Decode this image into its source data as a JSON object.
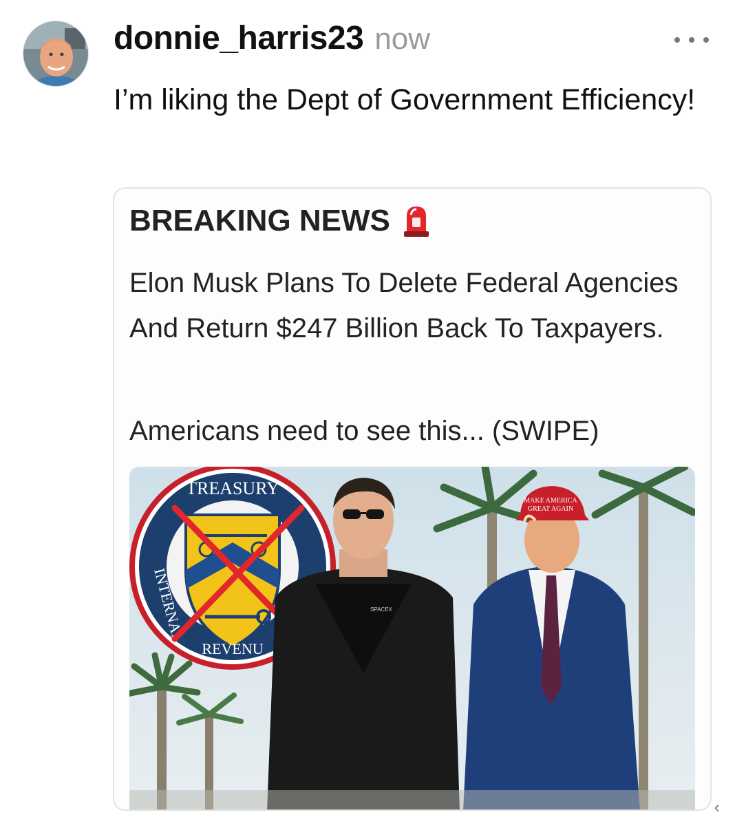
{
  "post": {
    "username": "donnie_harris23",
    "timestamp": "now",
    "text": "I’m liking the Dept of Government Efficiency!",
    "more_icon": "more-horizontal-icon"
  },
  "card": {
    "headline": "BREAKING NEWS",
    "headline_icon": "siren-icon",
    "body": "Elon Musk Plans To Delete Federal Agencies And Return $247 Billion Back To Taxpayers.",
    "cta": "Americans need to see this... (SWIPE)",
    "image": {
      "seal_top_text": "TREASURY",
      "seal_left_text": "INTERNAL",
      "seal_bottom_text": "REVENU",
      "hat_text_line1": "MAKE AMERICA",
      "hat_text_line2": "GREAT AGAIN",
      "shirt_text": "SPACEX"
    }
  },
  "colors": {
    "text": "#111111",
    "muted": "#9a9a9a",
    "card_border": "#e3e3e3",
    "alert_red": "#e2262b"
  }
}
